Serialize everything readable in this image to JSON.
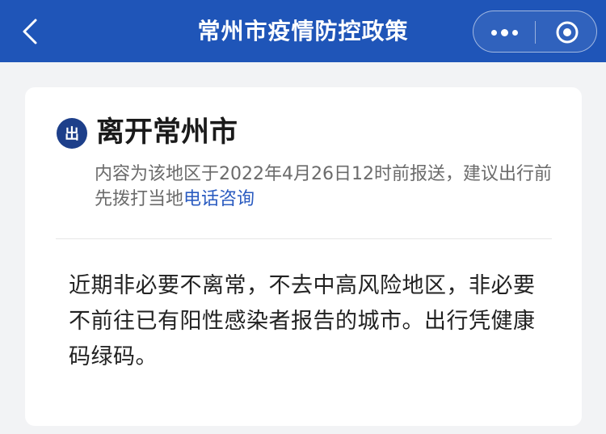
{
  "header": {
    "title": "常州市疫情防控政策",
    "back_icon": "chevron-left-icon",
    "more_icon": "more-dots-icon",
    "close_icon": "target-circle-icon",
    "background_color": "#1f55b8"
  },
  "card": {
    "badge": "出",
    "title": "离开常州市",
    "notice_prefix": "内容为该地区于2022年4月26日12时前报送，建议出行前先拨打当地",
    "notice_link": "电话咨询",
    "body": "近期非必要不离常，不去中高风险地区，非必要不前往已有阳性感染者报告的城市。出行凭健康码绿码。",
    "badge_color": "#1d3f8a",
    "link_color": "#2a5bc0"
  }
}
